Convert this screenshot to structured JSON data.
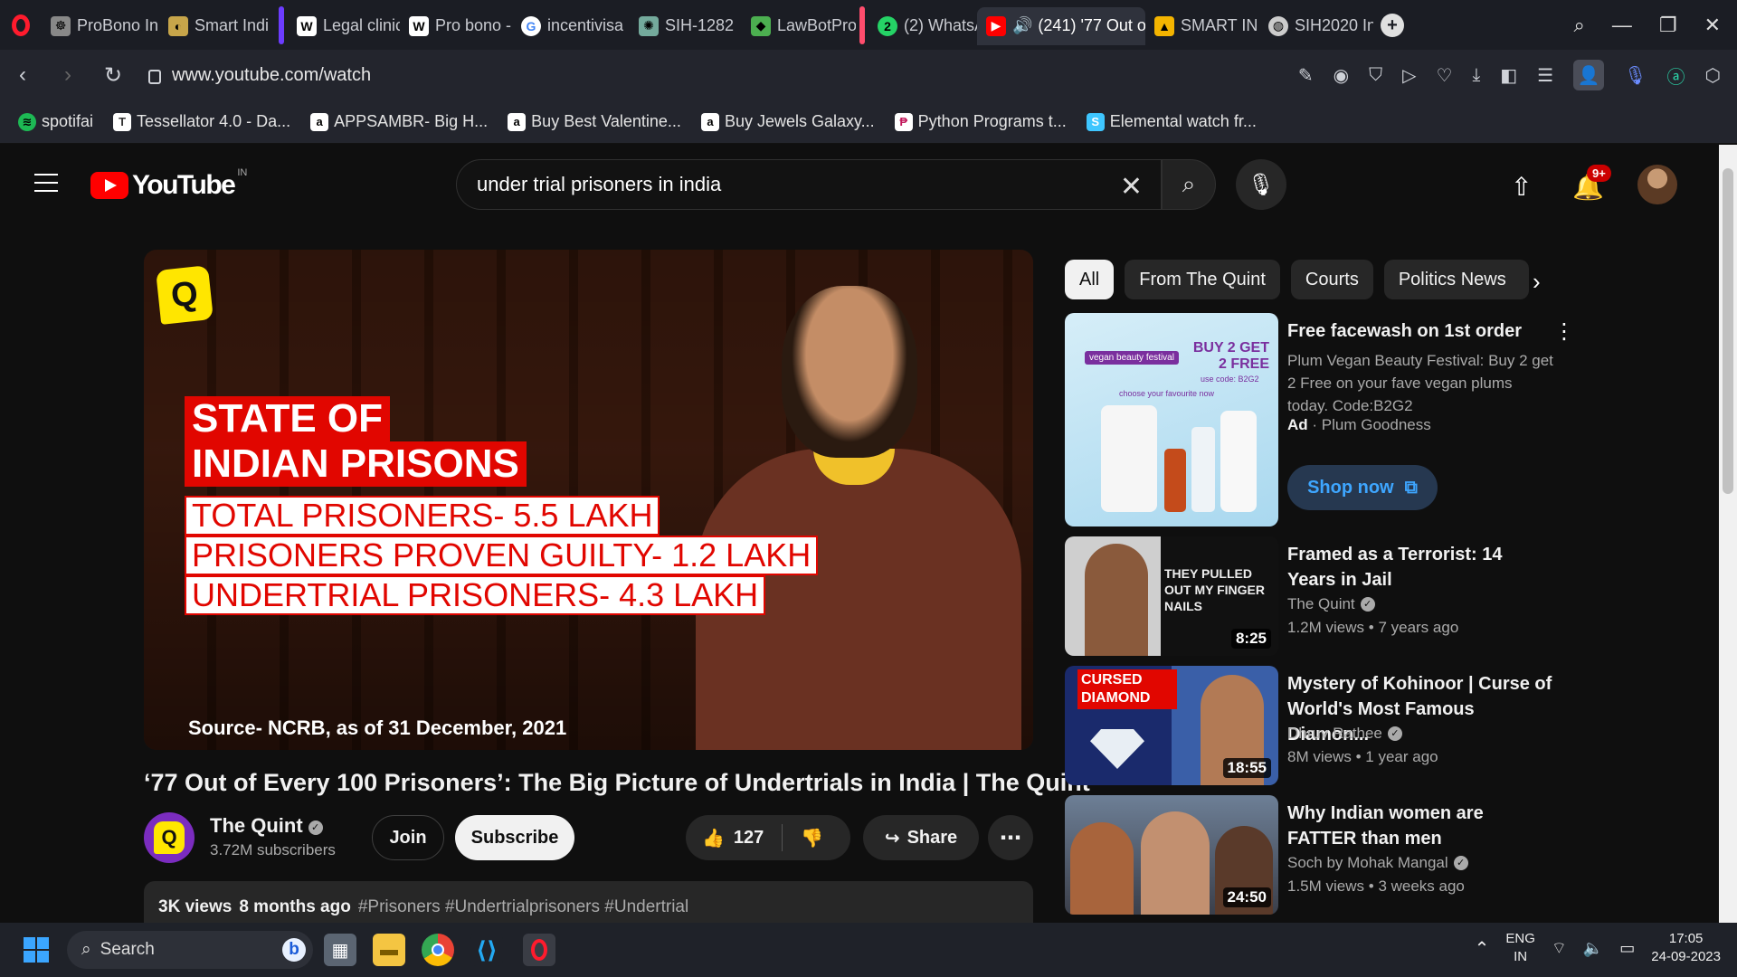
{
  "browser": {
    "tabs": [
      {
        "label": "ProBono In",
        "icon": "probono-icon",
        "color": "#888888"
      },
      {
        "label": "Smart Indi",
        "icon": "smart-india-icon",
        "color": "#c7a54a"
      },
      {
        "label": "Legal clinic",
        "icon": "wikipedia-icon",
        "color": "#ffffff"
      },
      {
        "label": "Pro bono -",
        "icon": "wikipedia-icon",
        "color": "#ffffff"
      },
      {
        "label": "incentivisa",
        "icon": "google-icon",
        "color": "#ffffff"
      },
      {
        "label": "SIH-1282",
        "icon": "chatgpt-icon",
        "color": "#74aa9c"
      },
      {
        "label": "LawBotPro",
        "icon": "lawbot-icon",
        "color": "#4caf50"
      },
      {
        "label": "(2) WhatsA",
        "icon": "whatsapp-icon",
        "color": "#25d366"
      },
      {
        "label": "(241) '77 Out o",
        "icon": "youtube-icon",
        "color": "#ff0000"
      },
      {
        "label": "SMART IN",
        "icon": "drive-icon",
        "color": "#f4b400"
      },
      {
        "label": "SIH2020 In",
        "icon": "globe-icon",
        "color": "#cccccc"
      }
    ],
    "url": "www.youtube.com/watch",
    "bookmarks": [
      {
        "label": "spotifai",
        "icon": "spotify-icon",
        "color": "#1db954"
      },
      {
        "label": "Tessellator 4.0 - Da...",
        "icon": "tessellator-icon",
        "color": "#ffffff"
      },
      {
        "label": "APPSAMBR- Big H...",
        "icon": "amazon-icon",
        "color": "#ffffff"
      },
      {
        "label": "Buy Best Valentine...",
        "icon": "amazon-icon",
        "color": "#ffffff"
      },
      {
        "label": "Buy Jewels Galaxy...",
        "icon": "amazon-icon",
        "color": "#ffffff"
      },
      {
        "label": "Python Programs t...",
        "icon": "python-icon",
        "color": "#ffffff"
      },
      {
        "label": "Elemental watch fr...",
        "icon": "elemental-icon",
        "color": "#3ec6ff"
      }
    ]
  },
  "youtube": {
    "logo_text": "YouTube",
    "region": "IN",
    "search_query": "under trial prisoners in india",
    "notification_count": "9+",
    "video": {
      "overlay": {
        "title_lines": [
          "STATE OF",
          "INDIAN PRISONS"
        ],
        "stats": [
          "TOTAL PRISONERS- 5.5 LAKH",
          "PRISONERS PROVEN GUILTY- 1.2 LAKH",
          "UNDERTRIAL PRISONERS- 4.3 LAKH"
        ],
        "source": "Source- NCRB, as of 31 December, 2021"
      },
      "title": "‘77 Out of Every 100 Prisoners’: The Big Picture of Undertrials in India | The Quint",
      "channel": "The Quint",
      "subscribers": "3.72M subscribers",
      "join_label": "Join",
      "subscribe_label": "Subscribe",
      "likes": "127",
      "share_label": "Share",
      "views": "3K views",
      "age": "8 months ago",
      "tags": "#Prisoners #Undertrialprisoners #Undertrial"
    },
    "chips": [
      "All",
      "From The Quint",
      "Courts",
      "Politics News"
    ],
    "ad": {
      "title": "Free facewash on 1st order",
      "description": "Plum Vegan Beauty Festival: Buy 2 get 2 Free on your fave vegan plums today. Code:B2G2",
      "ad_label": "Ad",
      "advertiser": "Plum Goodness",
      "cta": "Shop now",
      "thumb_text": {
        "badge": "vegan beauty festival",
        "offer": "BUY 2 GET 2 FREE",
        "code": "use code: B2G2",
        "sub": "choose your favourite now"
      }
    },
    "recommendations": [
      {
        "title": "Framed as a Terrorist: 14 Years in Jail",
        "channel": "The Quint",
        "views": "1.2M views",
        "age": "7 years ago",
        "duration": "8:25",
        "thumb_text": "THEY PULLED OUT MY FINGER NAILS"
      },
      {
        "title": "Mystery of Kohinoor | Curse of World's Most Famous Diamon...",
        "channel": "Dhruv Rathee",
        "views": "8M views",
        "age": "1 year ago",
        "duration": "18:55",
        "thumb_text": "CURSED DIAMOND"
      },
      {
        "title": "Why Indian women are FATTER than men",
        "channel": "Soch by Mohak Mangal",
        "views": "1.5M views",
        "age": "3 weeks ago",
        "duration": "24:50",
        "thumb_text": ""
      }
    ]
  },
  "taskbar": {
    "search_placeholder": "Search",
    "lang": "ENG",
    "region": "IN",
    "time": "17:05",
    "date": "24-09-2023"
  }
}
